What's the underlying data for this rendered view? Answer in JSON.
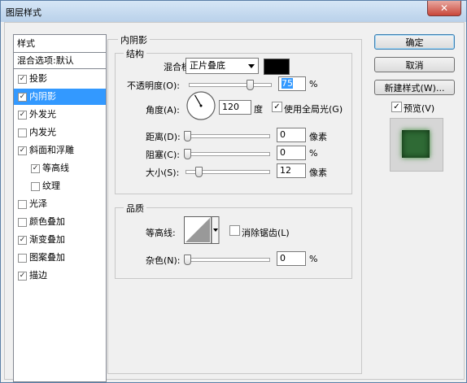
{
  "window": {
    "title": "图层样式",
    "close_glyph": "✕"
  },
  "styles_list": {
    "header": "样式",
    "blend_options": "混合选项:默认",
    "items": [
      {
        "label": "投影",
        "checked": true,
        "selected": false,
        "sub": false
      },
      {
        "label": "内阴影",
        "checked": true,
        "selected": true,
        "sub": false
      },
      {
        "label": "外发光",
        "checked": true,
        "selected": false,
        "sub": false
      },
      {
        "label": "内发光",
        "checked": false,
        "selected": false,
        "sub": false
      },
      {
        "label": "斜面和浮雕",
        "checked": true,
        "selected": false,
        "sub": false
      },
      {
        "label": "等高线",
        "checked": true,
        "selected": false,
        "sub": true
      },
      {
        "label": "纹理",
        "checked": false,
        "selected": false,
        "sub": true
      },
      {
        "label": "光泽",
        "checked": false,
        "selected": false,
        "sub": false
      },
      {
        "label": "颜色叠加",
        "checked": false,
        "selected": false,
        "sub": false
      },
      {
        "label": "渐变叠加",
        "checked": true,
        "selected": false,
        "sub": false
      },
      {
        "label": "图案叠加",
        "checked": false,
        "selected": false,
        "sub": false
      },
      {
        "label": "描边",
        "checked": true,
        "selected": false,
        "sub": false
      }
    ]
  },
  "inner_shadow": {
    "title": "内阴影",
    "structure": {
      "title": "结构",
      "blend_mode_label": "混合模式:",
      "blend_mode_value": "正片叠底",
      "blend_color": "#000000",
      "opacity_label": "不透明度(O):",
      "opacity_value": "75",
      "opacity_unit": "%",
      "opacity_fraction": 0.75,
      "angle_label": "角度(A):",
      "angle_value": "120",
      "angle_unit": "度",
      "angle_degrees": 120,
      "global_light_label": "使用全局光(G)",
      "global_light_checked": true,
      "distance_label": "距离(D):",
      "distance_value": "0",
      "distance_unit": "像素",
      "choke_label": "阻塞(C):",
      "choke_value": "0",
      "choke_unit": "%",
      "size_label": "大小(S):",
      "size_value": "12",
      "size_unit": "像素"
    },
    "quality": {
      "title": "品质",
      "contour_label": "等高线:",
      "antialias_label": "消除锯齿(L)",
      "antialias_checked": false,
      "noise_label": "杂色(N):",
      "noise_value": "0",
      "noise_unit": "%"
    }
  },
  "buttons": {
    "ok": "确定",
    "cancel": "取消",
    "new_style": "新建样式(W)...",
    "preview_label": "预览(V)",
    "preview_checked": true
  },
  "colors": {
    "selection": "#3399ff",
    "preview_fill": "#2f6a35"
  }
}
